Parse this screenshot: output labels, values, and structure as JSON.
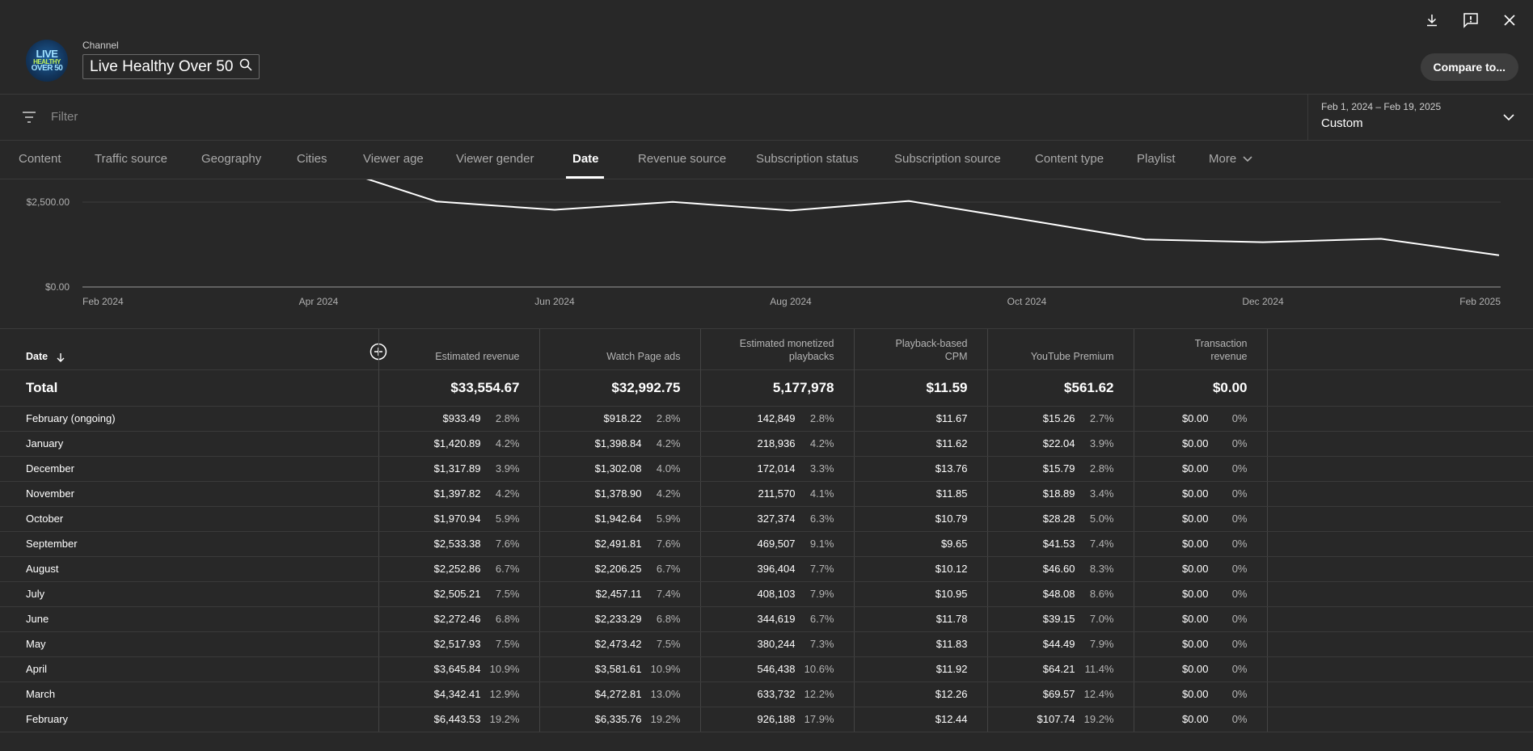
{
  "header": {
    "channel_label": "Channel",
    "channel_name": "Live Healthy Over 50",
    "logo_lines": [
      "LIVE",
      "HEALTHY",
      "OVER 50"
    ],
    "compare_label": "Compare to...",
    "icons": [
      "download-icon",
      "feedback-icon",
      "close-icon"
    ]
  },
  "filter": {
    "placeholder": "Filter",
    "date_range": "Feb 1, 2024 – Feb 19, 2025",
    "date_mode": "Custom"
  },
  "tabs": [
    {
      "label": "Content"
    },
    {
      "label": "Traffic source"
    },
    {
      "label": "Geography"
    },
    {
      "label": "Cities"
    },
    {
      "label": "Viewer age"
    },
    {
      "label": "Viewer gender"
    },
    {
      "label": "Date",
      "active": true
    },
    {
      "label": "Revenue source"
    },
    {
      "label": "Subscription status"
    },
    {
      "label": "Subscription source"
    },
    {
      "label": "Content type"
    },
    {
      "label": "Playlist"
    },
    {
      "label": "More"
    }
  ],
  "chart_data": {
    "type": "line",
    "y_ticks": [
      "$2,500.00",
      "$0.00"
    ],
    "x_ticks": [
      "Feb 2024",
      "Apr 2024",
      "Jun 2024",
      "Aug 2024",
      "Oct 2024",
      "Dec 2024",
      "Feb 2025"
    ],
    "series": [
      {
        "x": [
          "Apr 2024",
          "May 2024",
          "Jun 2024",
          "Jul 2024",
          "Aug 2024",
          "Sep 2024",
          "Oct 2024",
          "Nov 2024",
          "Dec 2024",
          "Jan 2025",
          "Feb 2025"
        ],
        "values": [
          3645.84,
          2517.93,
          2272.46,
          2505.21,
          2252.86,
          2533.38,
          1970.94,
          1397.82,
          1317.89,
          1420.89,
          933.49
        ]
      }
    ],
    "ylim": [
      0,
      2500
    ],
    "line_color": "#ffffff"
  },
  "table": {
    "headers": {
      "date": "Date",
      "est_revenue": "Estimated revenue",
      "watch_ads": "Watch Page ads",
      "monetized_1": "Estimated monetized",
      "monetized_2": "playbacks",
      "cpm_1": "Playback-based",
      "cpm_2": "CPM",
      "premium": "YouTube Premium",
      "trans_1": "Transaction",
      "trans_2": "revenue"
    },
    "total": {
      "label": "Total",
      "est_revenue": "$33,554.67",
      "watch_ads": "$32,992.75",
      "monetized": "5,177,978",
      "cpm": "$11.59",
      "premium": "$561.62",
      "trans": "$0.00"
    },
    "rows": [
      {
        "date": "February (ongoing)",
        "rev": "$933.49",
        "rev_p": "2.8%",
        "ads": "$918.22",
        "ads_p": "2.8%",
        "mon": "142,849",
        "mon_p": "2.8%",
        "cpm": "$11.67",
        "prem": "$15.26",
        "prem_p": "2.7%",
        "tr": "$0.00",
        "tr_p": "0%"
      },
      {
        "date": "January",
        "rev": "$1,420.89",
        "rev_p": "4.2%",
        "ads": "$1,398.84",
        "ads_p": "4.2%",
        "mon": "218,936",
        "mon_p": "4.2%",
        "cpm": "$11.62",
        "prem": "$22.04",
        "prem_p": "3.9%",
        "tr": "$0.00",
        "tr_p": "0%"
      },
      {
        "date": "December",
        "rev": "$1,317.89",
        "rev_p": "3.9%",
        "ads": "$1,302.08",
        "ads_p": "4.0%",
        "mon": "172,014",
        "mon_p": "3.3%",
        "cpm": "$13.76",
        "prem": "$15.79",
        "prem_p": "2.8%",
        "tr": "$0.00",
        "tr_p": "0%"
      },
      {
        "date": "November",
        "rev": "$1,397.82",
        "rev_p": "4.2%",
        "ads": "$1,378.90",
        "ads_p": "4.2%",
        "mon": "211,570",
        "mon_p": "4.1%",
        "cpm": "$11.85",
        "prem": "$18.89",
        "prem_p": "3.4%",
        "tr": "$0.00",
        "tr_p": "0%"
      },
      {
        "date": "October",
        "rev": "$1,970.94",
        "rev_p": "5.9%",
        "ads": "$1,942.64",
        "ads_p": "5.9%",
        "mon": "327,374",
        "mon_p": "6.3%",
        "cpm": "$10.79",
        "prem": "$28.28",
        "prem_p": "5.0%",
        "tr": "$0.00",
        "tr_p": "0%"
      },
      {
        "date": "September",
        "rev": "$2,533.38",
        "rev_p": "7.6%",
        "ads": "$2,491.81",
        "ads_p": "7.6%",
        "mon": "469,507",
        "mon_p": "9.1%",
        "cpm": "$9.65",
        "prem": "$41.53",
        "prem_p": "7.4%",
        "tr": "$0.00",
        "tr_p": "0%"
      },
      {
        "date": "August",
        "rev": "$2,252.86",
        "rev_p": "6.7%",
        "ads": "$2,206.25",
        "ads_p": "6.7%",
        "mon": "396,404",
        "mon_p": "7.7%",
        "cpm": "$10.12",
        "prem": "$46.60",
        "prem_p": "8.3%",
        "tr": "$0.00",
        "tr_p": "0%"
      },
      {
        "date": "July",
        "rev": "$2,505.21",
        "rev_p": "7.5%",
        "ads": "$2,457.11",
        "ads_p": "7.4%",
        "mon": "408,103",
        "mon_p": "7.9%",
        "cpm": "$10.95",
        "prem": "$48.08",
        "prem_p": "8.6%",
        "tr": "$0.00",
        "tr_p": "0%"
      },
      {
        "date": "June",
        "rev": "$2,272.46",
        "rev_p": "6.8%",
        "ads": "$2,233.29",
        "ads_p": "6.8%",
        "mon": "344,619",
        "mon_p": "6.7%",
        "cpm": "$11.78",
        "prem": "$39.15",
        "prem_p": "7.0%",
        "tr": "$0.00",
        "tr_p": "0%"
      },
      {
        "date": "May",
        "rev": "$2,517.93",
        "rev_p": "7.5%",
        "ads": "$2,473.42",
        "ads_p": "7.5%",
        "mon": "380,244",
        "mon_p": "7.3%",
        "cpm": "$11.83",
        "prem": "$44.49",
        "prem_p": "7.9%",
        "tr": "$0.00",
        "tr_p": "0%"
      },
      {
        "date": "April",
        "rev": "$3,645.84",
        "rev_p": "10.9%",
        "ads": "$3,581.61",
        "ads_p": "10.9%",
        "mon": "546,438",
        "mon_p": "10.6%",
        "cpm": "$11.92",
        "prem": "$64.21",
        "prem_p": "11.4%",
        "tr": "$0.00",
        "tr_p": "0%"
      },
      {
        "date": "March",
        "rev": "$4,342.41",
        "rev_p": "12.9%",
        "ads": "$4,272.81",
        "ads_p": "13.0%",
        "mon": "633,732",
        "mon_p": "12.2%",
        "cpm": "$12.26",
        "prem": "$69.57",
        "prem_p": "12.4%",
        "tr": "$0.00",
        "tr_p": "0%"
      },
      {
        "date": "February",
        "rev": "$6,443.53",
        "rev_p": "19.2%",
        "ads": "$6,335.76",
        "ads_p": "19.2%",
        "mon": "926,188",
        "mon_p": "17.9%",
        "cpm": "$12.44",
        "prem": "$107.74",
        "prem_p": "19.2%",
        "tr": "$0.00",
        "tr_p": "0%"
      }
    ]
  }
}
